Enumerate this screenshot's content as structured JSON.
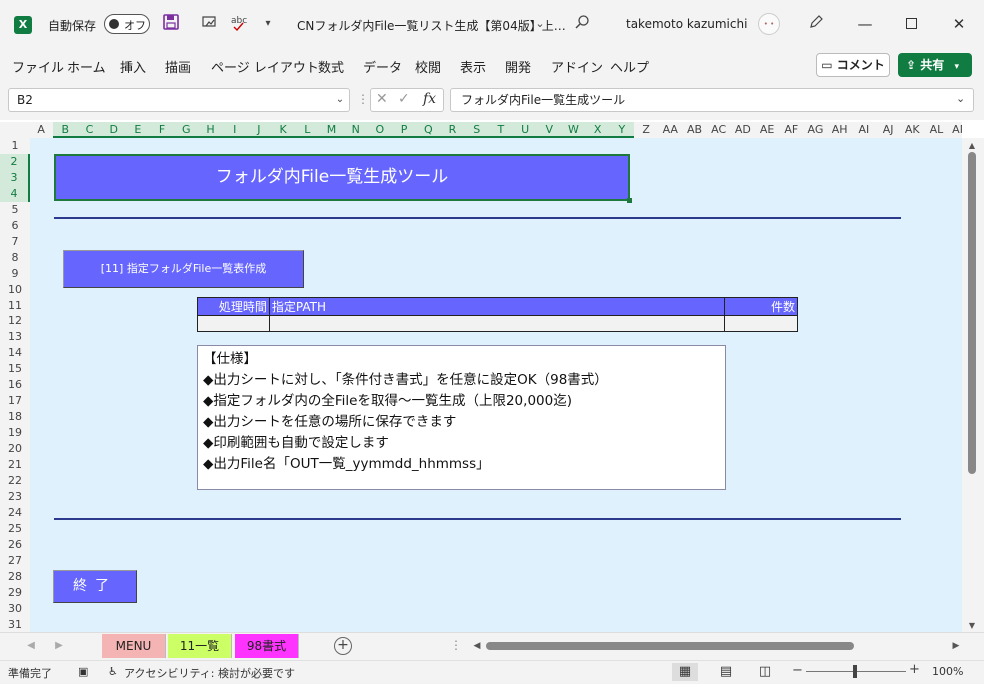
{
  "titlebar": {
    "app_icon": "X",
    "autosave_label": "自動保存",
    "autosave_state": "オフ",
    "doc_title": "CNフォルダ内File一覧リスト生成【第04版】上…",
    "user_name": "takemoto kazumichi",
    "icons": [
      "save-icon",
      "touch-mode-icon",
      "spell-check-icon",
      "customize-qat-icon",
      "title-dropdown-icon",
      "search-icon",
      "avatar",
      "pen-icon",
      "minimize-icon",
      "maximize-icon",
      "close-icon"
    ]
  },
  "menu": {
    "items": [
      "ファイル",
      "ホーム",
      "挿入",
      "描画",
      "ページ レイアウト",
      "数式",
      "データ",
      "校閲",
      "表示",
      "開発",
      "アドイン",
      "ヘルプ"
    ],
    "comment_label": "コメント",
    "share_label": "共有"
  },
  "formula_bar": {
    "name_box": "B2",
    "fx": "fx",
    "formula": "フォルダ内File一覧生成ツール"
  },
  "grid": {
    "columns": [
      "A",
      "B",
      "C",
      "D",
      "E",
      "F",
      "G",
      "H",
      "I",
      "J",
      "K",
      "L",
      "M",
      "N",
      "O",
      "P",
      "Q",
      "R",
      "S",
      "T",
      "U",
      "V",
      "W",
      "X",
      "Y",
      "Z",
      "AA",
      "AB",
      "AC",
      "AD",
      "AE",
      "AF",
      "AG",
      "AH",
      "AI",
      "AJ",
      "AK",
      "AL",
      "AM"
    ],
    "rows": [
      "1",
      "2",
      "3",
      "4",
      "5",
      "6",
      "7",
      "8",
      "9",
      "10",
      "11",
      "12",
      "13",
      "14",
      "15",
      "16",
      "17",
      "18",
      "19",
      "20",
      "21",
      "22",
      "23",
      "24",
      "25",
      "26",
      "27",
      "28",
      "29",
      "30",
      "31"
    ],
    "selected_column_range": [
      "B",
      "Y"
    ],
    "selected_row_range": [
      "2",
      "4"
    ]
  },
  "sheet": {
    "title": "フォルダ内File一覧生成ツール",
    "list_button": "[11] 指定フォルダFile一覧表作成",
    "table": {
      "headers": [
        "処理時間",
        "指定PATH",
        "件数"
      ],
      "row": [
        "",
        "",
        ""
      ]
    },
    "spec": [
      "【仕様】",
      "◆出力シートに対し、「条件付き書式」を任意に設定OK（98書式）",
      "◆指定フォルダ内の全Fileを取得～一覧生成（上限20,000迄)",
      "◆出力シートを任意の場所に保存できます",
      "◆印刷範囲も自動で設定します",
      "◆出力File名「OUT一覧_yymmdd_hhmmss」"
    ],
    "exit_button": "終了"
  },
  "tabs": [
    {
      "label": "MENU",
      "color": "#f4b4b4"
    },
    {
      "label": "11一覧",
      "color": "#ccff66"
    },
    {
      "label": "98書式",
      "color": "#ff33ff"
    }
  ],
  "status": {
    "ready": "準備完了",
    "accessibility": "アクセシビリティ: 検討が必要です",
    "zoom": "100%",
    "zoom_value": 100
  },
  "colors": {
    "accent": "#107c41",
    "sheet_bg": "#dff1fc",
    "button_fill": "#6666ff",
    "rule": "#2b3a8c"
  }
}
